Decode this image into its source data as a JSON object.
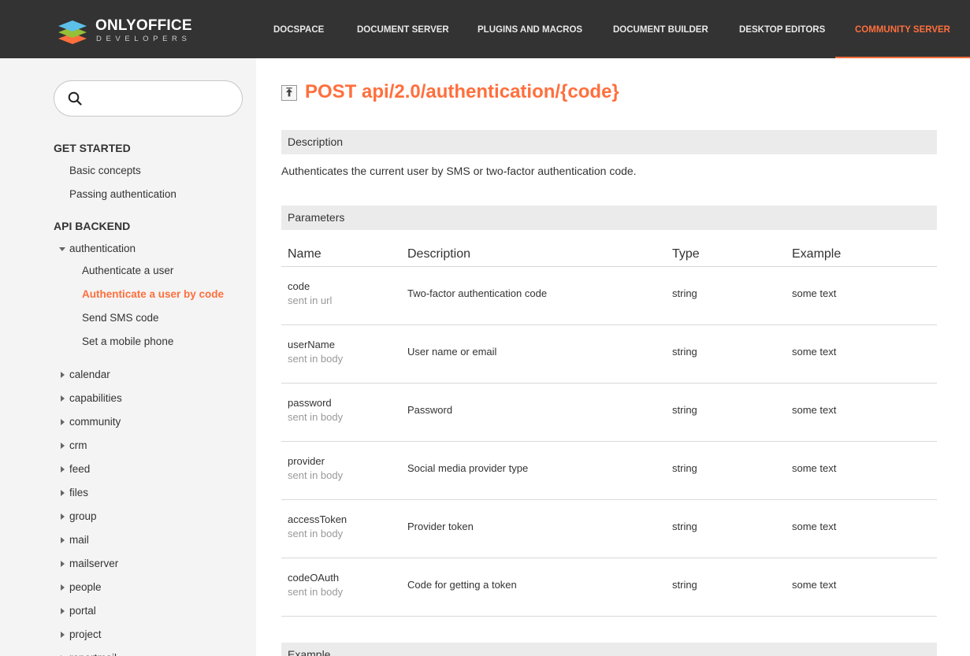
{
  "header": {
    "logo_title": "ONLYOFFICE",
    "logo_subtitle": "DEVELOPERS",
    "nav": [
      {
        "label": "DOCSPACE",
        "active": false
      },
      {
        "label": "DOCUMENT SERVER",
        "active": false
      },
      {
        "label": "PLUGINS AND MACROS",
        "active": false
      },
      {
        "label": "DOCUMENT BUILDER",
        "active": false
      },
      {
        "label": "DESKTOP EDITORS",
        "active": false
      },
      {
        "label": "COMMUNITY SERVER",
        "active": true
      }
    ]
  },
  "sidebar": {
    "search_value": "",
    "sections": [
      {
        "title": "GET STARTED",
        "items": [
          "Basic concepts",
          "Passing authentication"
        ]
      },
      {
        "title": "API BACKEND"
      }
    ],
    "tree": {
      "expanded_label": "authentication",
      "children": [
        {
          "label": "Authenticate a user",
          "active": false
        },
        {
          "label": "Authenticate a user by code",
          "active": true
        },
        {
          "label": "Send SMS code",
          "active": false
        },
        {
          "label": "Set a mobile phone",
          "active": false
        }
      ],
      "collapsed": [
        "calendar",
        "capabilities",
        "community",
        "crm",
        "feed",
        "files",
        "group",
        "mail",
        "mailserver",
        "people",
        "portal",
        "project",
        "reportmail"
      ]
    }
  },
  "main": {
    "title": "POST api/2.0/authentication/{code}",
    "description_heading": "Description",
    "description_text": "Authenticates the current user by SMS or two-factor authentication code.",
    "parameters_heading": "Parameters",
    "columns": [
      "Name",
      "Description",
      "Type",
      "Example"
    ],
    "params": [
      {
        "name": "code",
        "sent": "sent in url",
        "description": "Two-factor authentication code",
        "type": "string",
        "example": "some text"
      },
      {
        "name": "userName",
        "sent": "sent in body",
        "description": "User name or email",
        "type": "string",
        "example": "some text"
      },
      {
        "name": "password",
        "sent": "sent in body",
        "description": "Password",
        "type": "string",
        "example": "some text"
      },
      {
        "name": "provider",
        "sent": "sent in body",
        "description": "Social media provider type",
        "type": "string",
        "example": "some text"
      },
      {
        "name": "accessToken",
        "sent": "sent in body",
        "description": "Provider token",
        "type": "string",
        "example": "some text"
      },
      {
        "name": "codeOAuth",
        "sent": "sent in body",
        "description": "Code for getting a token",
        "type": "string",
        "example": "some text"
      }
    ],
    "example_heading": "Example"
  },
  "icons": {
    "search": "search-icon",
    "back": "back-to-top-icon",
    "expand": "triangle-down-icon",
    "collapse": "triangle-right-icon"
  },
  "colors": {
    "accent": "#ff6f3d",
    "header_bg": "#333333",
    "sidebar_bg": "#f4f4f4",
    "bar_bg": "#ebebeb"
  }
}
